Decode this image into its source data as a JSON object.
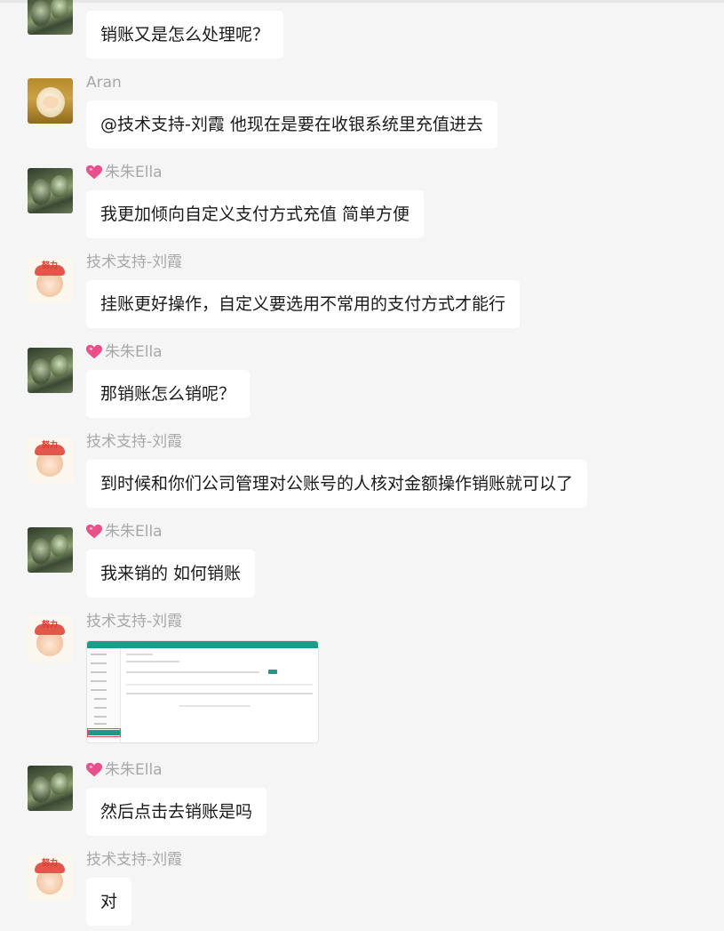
{
  "messages": [
    {
      "sender": "",
      "avatar": "zhu",
      "text": "销账又是怎么处理呢？"
    },
    {
      "sender": "Aran",
      "avatar": "aran",
      "text": "@技术支持-刘霞 他现在是要在收银系统里充值进去"
    },
    {
      "sender": "朱朱Ella",
      "avatar": "zhu",
      "text": "我更加倾向自定义支付方式充值 简单方便"
    },
    {
      "sender": "技术支持-刘霞",
      "avatar": "liu",
      "text": "挂账更好操作，自定义要选用不常用的支付方式才能行"
    },
    {
      "sender": "朱朱Ella",
      "avatar": "zhu",
      "text": "那销账怎么销呢？"
    },
    {
      "sender": "技术支持-刘霞",
      "avatar": "liu",
      "text": "到时候和你们公司管理对公账号的人核对金额操作销账就可以了"
    },
    {
      "sender": "朱朱Ella",
      "avatar": "zhu",
      "text": "我来销的 如何销账"
    },
    {
      "sender": "技术支持-刘霞",
      "avatar": "liu",
      "text": ""
    },
    {
      "sender": "朱朱Ella",
      "avatar": "zhu",
      "text": "然后点击去销账是吗"
    },
    {
      "sender": "技术支持-刘霞",
      "avatar": "liu",
      "text": "对"
    }
  ],
  "avatar_text": {
    "liu": "努力"
  },
  "colors": {
    "background": "#f5f5f5",
    "bubble": "#ffffff",
    "sender_name": "#a8a8a8",
    "heart": "#e94f8a",
    "thumb_accent": "#1e9a8a"
  }
}
